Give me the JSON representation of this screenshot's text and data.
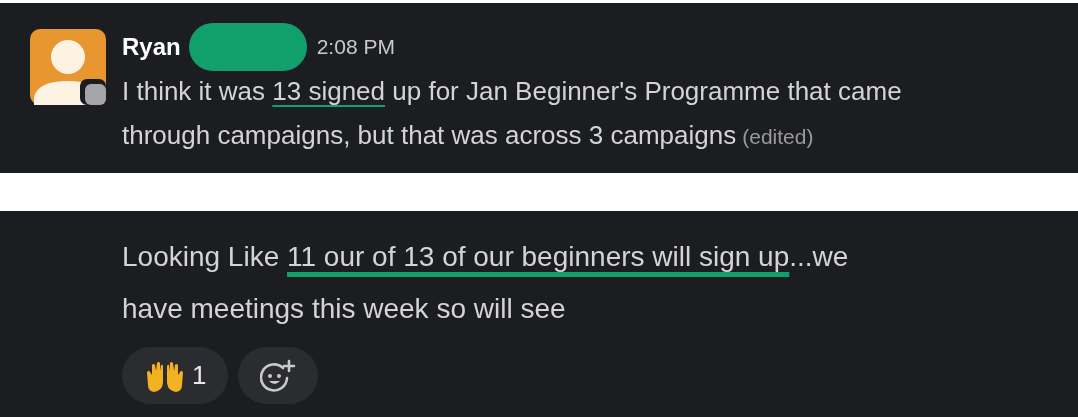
{
  "messages": [
    {
      "author": "Ryan",
      "name_redacted": true,
      "time": "2:08 PM",
      "lines": [
        [
          {
            "text": "I think it was ",
            "highlighted": false
          },
          {
            "text": "13 signed",
            "highlighted": true
          },
          {
            "text": " up for Jan Beginner's Programme that came",
            "highlighted": false
          }
        ],
        [
          {
            "text": "through campaigns, but that was across 3 campaigns",
            "highlighted": false
          }
        ]
      ],
      "edited": "(edited)"
    },
    {
      "lines": [
        [
          {
            "text": "Looking Like ",
            "highlighted": false
          },
          {
            "text": "11 our of 13 of our beginners will sign up",
            "highlighted": true
          },
          {
            "text": "...we",
            "highlighted": false
          }
        ],
        [
          {
            "text": "have meetings this week so will see",
            "highlighted": false
          }
        ]
      ],
      "reactions": [
        {
          "kind": "raised_hands",
          "count": "1"
        }
      ]
    }
  ]
}
